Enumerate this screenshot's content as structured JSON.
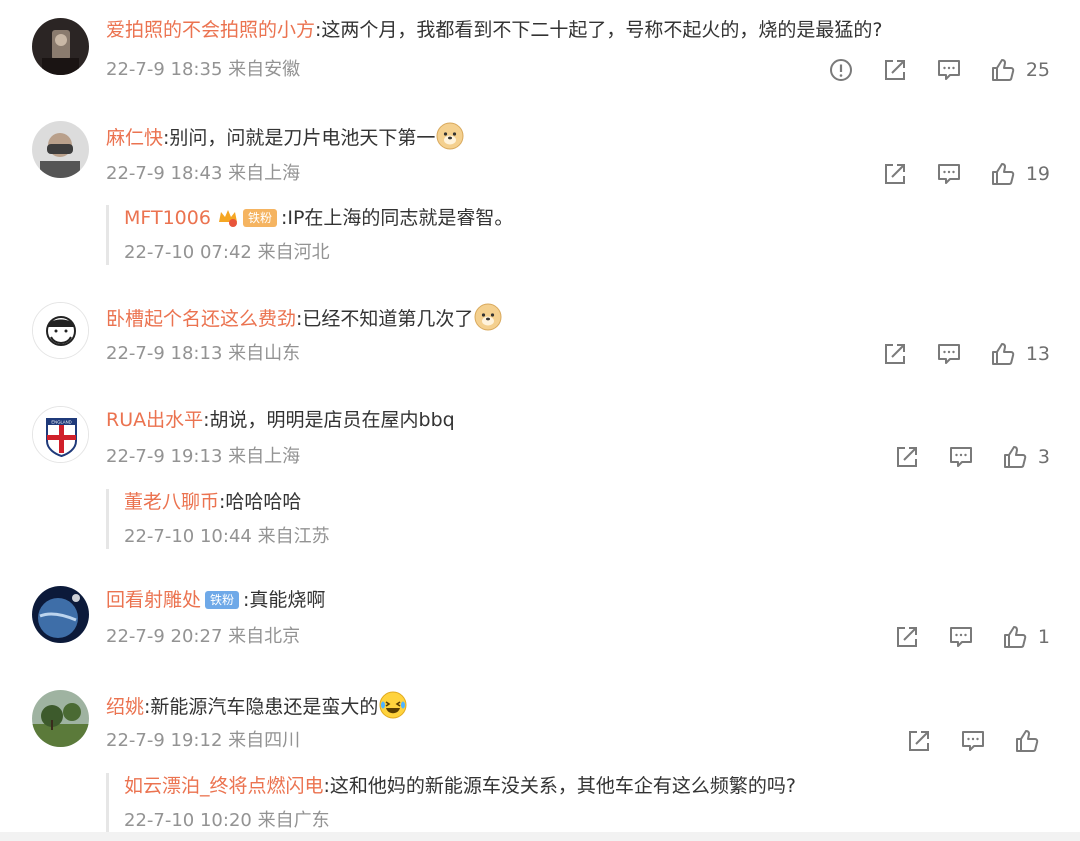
{
  "comments": [
    {
      "user": "爱拍照的不会拍照的小方",
      "text": ":这两个月，我都看到不下二十起了，号称不起火的，烧的是最猛的?",
      "time": "22-7-9 18:35 来自安徽",
      "likes": "25",
      "has_report": true
    },
    {
      "user": "麻仁快",
      "text": ":别问，问就是刀片电池天下第一",
      "time": "22-7-9 18:43 来自上海",
      "likes": "19",
      "reply": {
        "user": "MFT1006",
        "badge": "铁粉",
        "text": ":IP在上海的同志就是睿智。",
        "time": "22-7-10 07:42 来自河北"
      }
    },
    {
      "user": "卧槽起个名还这么费劲",
      "text": ":已经不知道第几次了",
      "time": "22-7-9 18:13 来自山东",
      "likes": "13"
    },
    {
      "user": "RUA出水平",
      "text": ":胡说，明明是店员在屋内bbq",
      "time": "22-7-9 19:13 来自上海",
      "likes": "3",
      "avatar_text": "ENGLAND",
      "reply": {
        "user": "董老八聊币",
        "text": ":哈哈哈哈",
        "time": "22-7-10 10:44 来自江苏"
      }
    },
    {
      "user": "回看射雕处",
      "badge": "铁粉",
      "text": ":真能烧啊",
      "time": "22-7-9 20:27 来自北京",
      "likes": "1"
    },
    {
      "user": "绍姚",
      "text": ":新能源汽车隐患还是蛮大的",
      "time": "22-7-9 19:12 来自四川",
      "likes": "",
      "reply": {
        "user": "如云漂泊_终将点燃闪电",
        "text": ":这和他妈的新能源车没关系，其他车企有这么频繁的吗?",
        "time": "22-7-10 10:20 来自广东"
      }
    }
  ],
  "icons": {
    "report": "report-icon",
    "share": "share-icon",
    "comment": "comment-icon",
    "like": "thumbs-up-icon"
  },
  "colors": {
    "username": "#eb7350",
    "meta": "#939393",
    "text": "#333333",
    "icon": "#7a7a7a",
    "badge_orange": "#f5b461",
    "badge_blue": "#6fa9e8"
  }
}
